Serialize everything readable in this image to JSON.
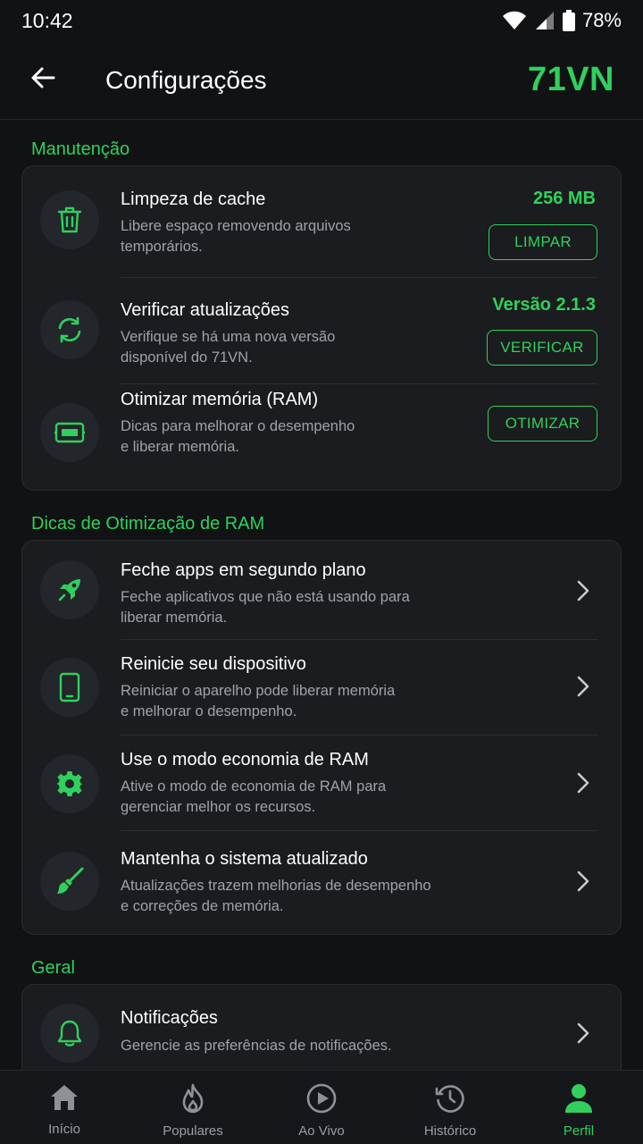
{
  "status": {
    "time": "10:42",
    "battery": "78%"
  },
  "header": {
    "title": "Configurações",
    "logo": "71VN"
  },
  "sections": {
    "maintenance": {
      "title": "Manutenção",
      "items": [
        {
          "title": "Limpeza de cache",
          "desc1": "Libere espaço removendo arquivos",
          "desc2": "temporários.",
          "value": "256 MB",
          "button": "LIMPAR",
          "icon": "trash-icon"
        },
        {
          "title": "Verificar atualizações",
          "desc1": "Verifique se há uma nova versão",
          "desc2": "disponível do 71VN.",
          "value": "Versão 2.1.3",
          "button": "VERIFICAR",
          "icon": "refresh-icon"
        },
        {
          "title": "Otimizar memória (RAM)",
          "desc1": "Dicas para melhorar o desempenho",
          "desc2": "e liberar memória.",
          "button": "OTIMIZAR",
          "icon": "memory-icon"
        }
      ]
    },
    "ram_tips": {
      "title": "Dicas de Otimização de RAM",
      "items": [
        {
          "title": "Feche apps em segundo plano",
          "desc1": "Feche aplicativos que não está usando para",
          "desc2": "liberar memória.",
          "icon": "rocket-icon"
        },
        {
          "title": "Reinicie seu dispositivo",
          "desc1": "Reiniciar o aparelho pode liberar memória",
          "desc2": "e melhorar o desempenho.",
          "icon": "phone-icon"
        },
        {
          "title": "Use o modo economia de RAM",
          "desc1": "Ative o modo de economia de RAM para",
          "desc2": "gerenciar melhor os recursos.",
          "icon": "gear-icon"
        },
        {
          "title": "Mantenha o sistema atualizado",
          "desc1": "Atualizações trazem melhorias de desempenho",
          "desc2": "e correções de memória.",
          "icon": "broom-icon"
        }
      ]
    },
    "general": {
      "title": "Geral",
      "items": [
        {
          "title": "Notificações",
          "desc1": "Gerencie as preferências de notificações.",
          "icon": "bell-icon"
        }
      ]
    }
  },
  "nav": [
    {
      "label": "Início",
      "icon": "home-icon"
    },
    {
      "label": "Populares",
      "icon": "flame-icon"
    },
    {
      "label": "Ao Vivo",
      "icon": "play-icon"
    },
    {
      "label": "Histórico",
      "icon": "history-icon"
    },
    {
      "label": "Perfil",
      "icon": "profile-icon",
      "active": true
    }
  ],
  "colors": {
    "accent": "#2fd15c",
    "background": "#111214",
    "card": "#1b1c1f"
  }
}
